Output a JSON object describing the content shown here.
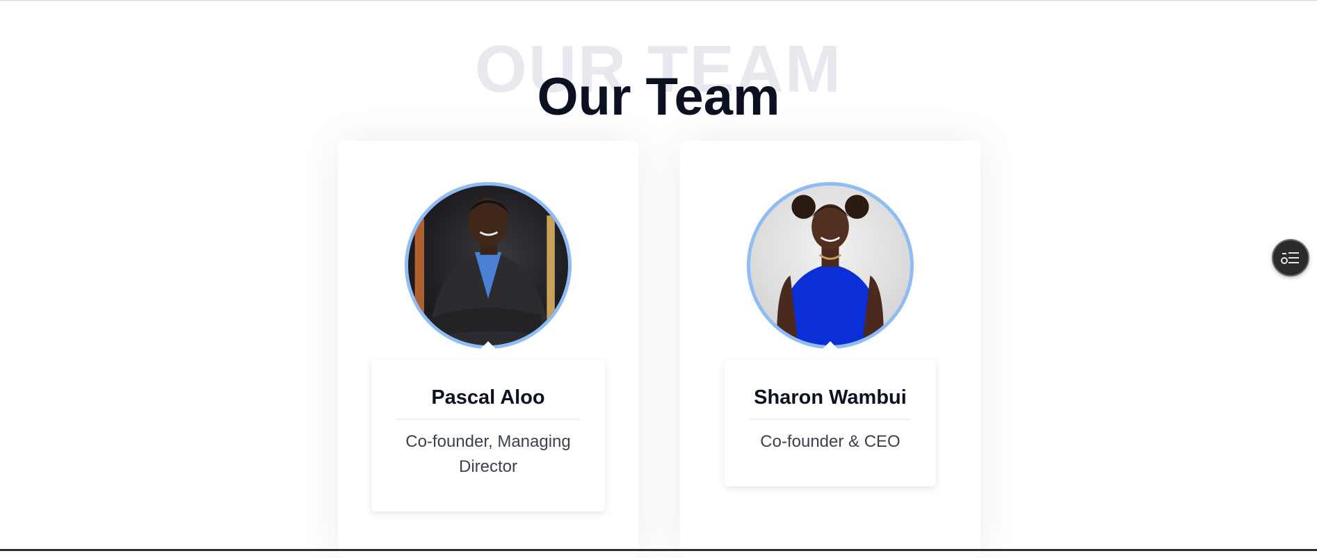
{
  "section": {
    "watermark": "OUR TEAM",
    "title": "Our Team"
  },
  "team": [
    {
      "name": "Pascal Aloo",
      "role": "Co-founder, Managing Director"
    },
    {
      "name": "Sharon Wambui",
      "role": "Co-founder & CEO"
    }
  ],
  "floating_button": {
    "icon": "list-icon"
  },
  "colors": {
    "avatar_ring": "#8fbcf5",
    "title": "#0b1120",
    "watermark": "#e8e9ee",
    "role_text": "#3b4150",
    "fab_bg": "#2b2b2e"
  }
}
